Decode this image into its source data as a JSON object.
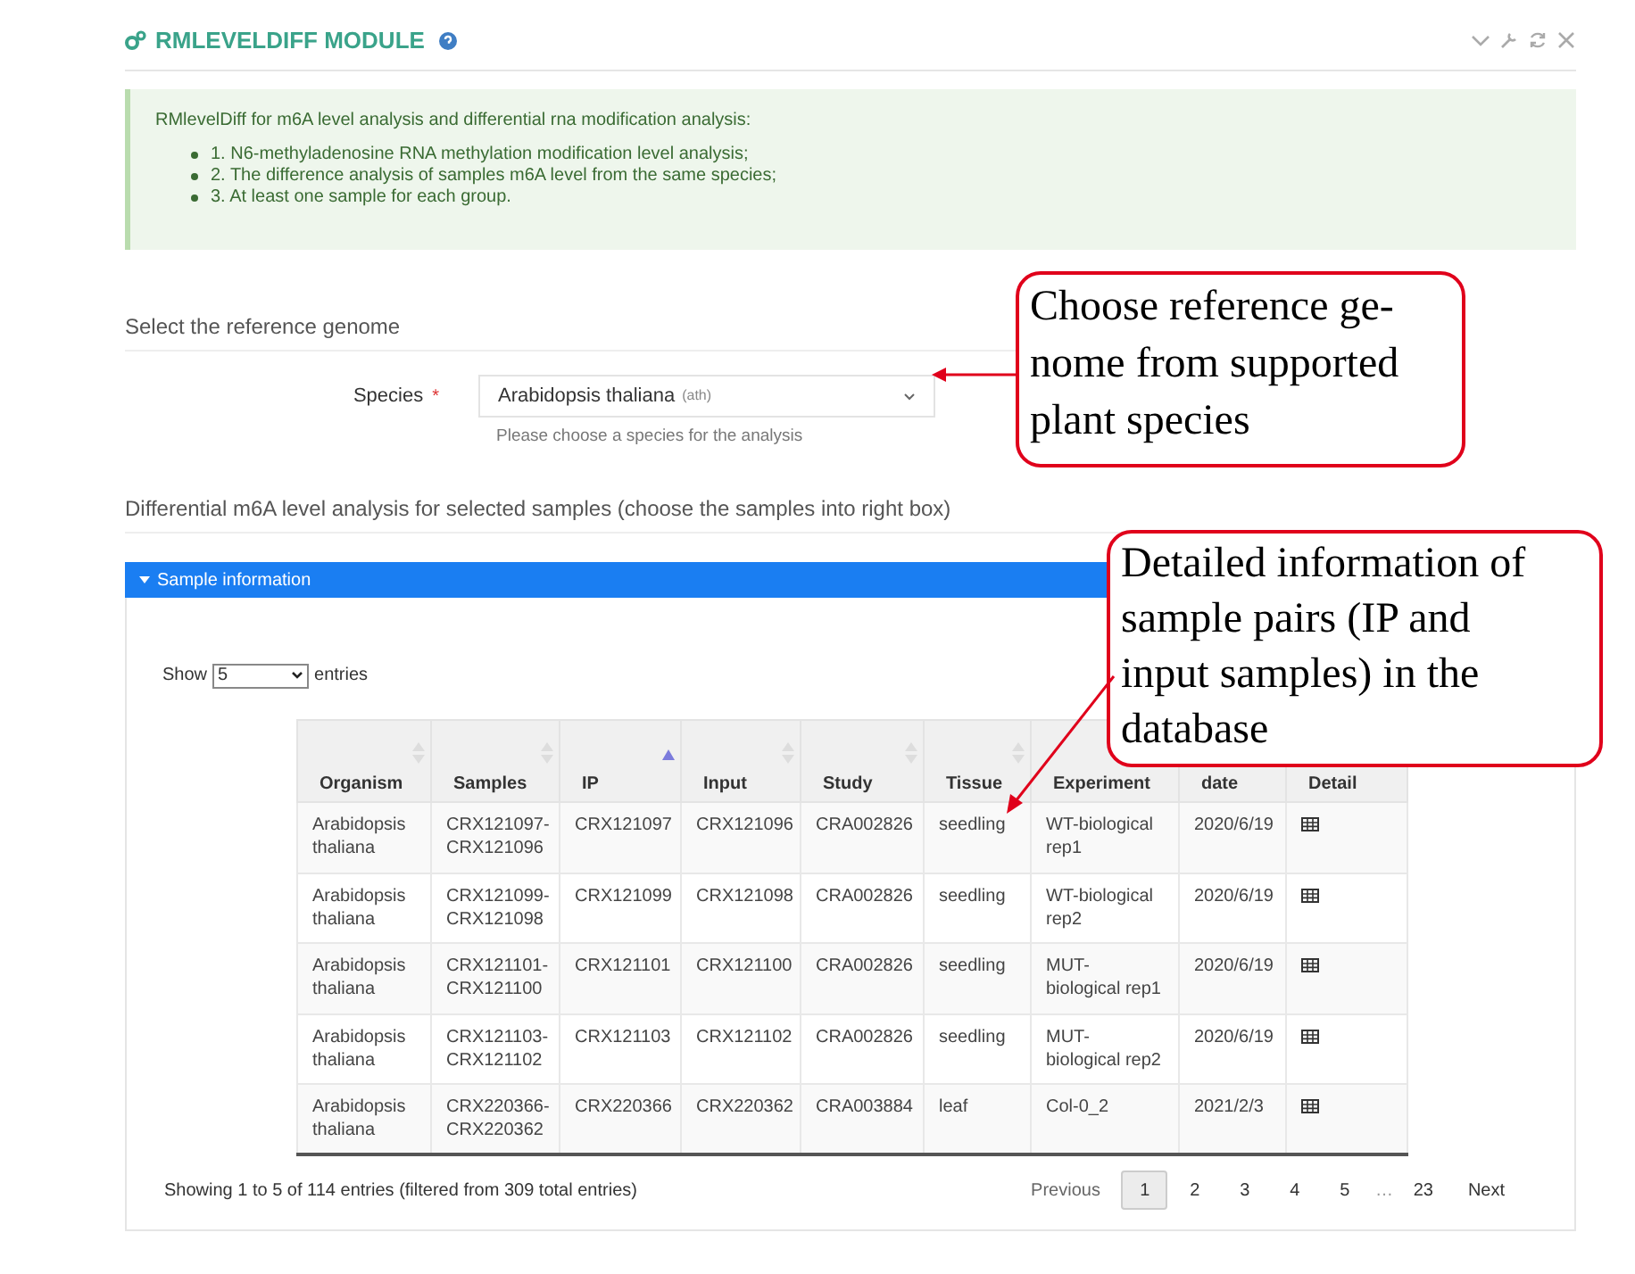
{
  "module": {
    "title": "RMLEVELDIFF MODULE"
  },
  "info": {
    "intro": "RMlevelDiff for m6A level analysis and differential rna modification analysis:",
    "items": [
      "1. N6-methyladenosine RNA methylation modification level analysis;",
      "2. The difference analysis of samples m6A level from the same species;",
      "3. At least one sample for each group."
    ]
  },
  "reference_section": {
    "heading": "Select the reference genome",
    "label": "Species",
    "required_mark": "*",
    "value": "Arabidopsis thaliana",
    "value_suffix": "(ath)",
    "help": "Please choose a species for the analysis"
  },
  "samples_section": {
    "heading": "Differential m6A level analysis for selected samples (choose the samples into right box)",
    "panel_title": "Sample information",
    "expanded": true
  },
  "table": {
    "length_prefix": "Show",
    "length_value": "5",
    "length_suffix": "entries",
    "columns": [
      {
        "label": "Organism",
        "sorted": false
      },
      {
        "label": "Samples",
        "sorted": false
      },
      {
        "label": "IP",
        "sorted": true
      },
      {
        "label": "Input",
        "sorted": false
      },
      {
        "label": "Study",
        "sorted": false
      },
      {
        "label": "Tissue",
        "sorted": false
      },
      {
        "label": "Experiment"
      },
      {
        "label": "date"
      },
      {
        "label": "Detail"
      }
    ],
    "rows": [
      [
        "Arabidopsis thaliana",
        "CRX121097-CRX121096",
        "CRX121097",
        "CRX121096",
        "CRA002826",
        "seedling",
        "WT-biological rep1",
        "2020/6/19"
      ],
      [
        "Arabidopsis thaliana",
        "CRX121099-CRX121098",
        "CRX121099",
        "CRX121098",
        "CRA002826",
        "seedling",
        "WT-biological rep2",
        "2020/6/19"
      ],
      [
        "Arabidopsis thaliana",
        "CRX121101-CRX121100",
        "CRX121101",
        "CRX121100",
        "CRA002826",
        "seedling",
        "MUT-biological rep1",
        "2020/6/19"
      ],
      [
        "Arabidopsis thaliana",
        "CRX121103-CRX121102",
        "CRX121103",
        "CRX121102",
        "CRA002826",
        "seedling",
        "MUT-biological rep2",
        "2020/6/19"
      ],
      [
        "Arabidopsis thaliana",
        "CRX220366-CRX220362",
        "CRX220366",
        "CRX220362",
        "CRA003884",
        "leaf",
        "Col-0_2",
        "2021/2/3"
      ]
    ],
    "info": "Showing 1 to 5 of 114 entries (filtered from 309 total entries)",
    "pagination": [
      {
        "label": "Previous",
        "kind": "nav"
      },
      {
        "label": "1",
        "kind": "page",
        "selected": true
      },
      {
        "label": "2",
        "kind": "page",
        "selected": false
      },
      {
        "label": "3",
        "kind": "page",
        "selected": false
      },
      {
        "label": "4",
        "kind": "page",
        "selected": false
      },
      {
        "label": "5",
        "kind": "page",
        "selected": false
      },
      {
        "label": "…",
        "kind": "ellipsis"
      },
      {
        "label": "23",
        "kind": "page",
        "selected": false
      },
      {
        "label": "Next",
        "kind": "nav"
      }
    ]
  },
  "annotations": [
    {
      "text": "Choose reference ge-nome from supported plant species"
    },
    {
      "text": "Detailed information of sample pairs (IP and input samples) in the database"
    }
  ]
}
